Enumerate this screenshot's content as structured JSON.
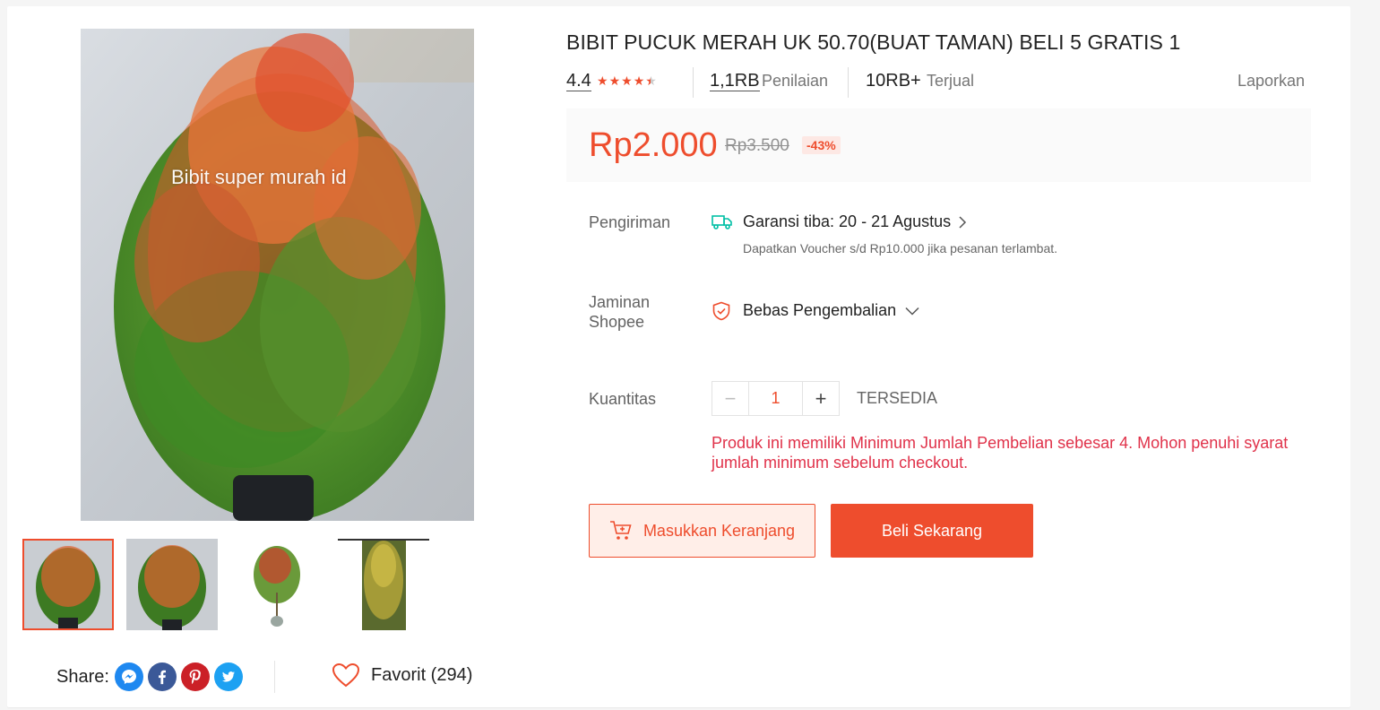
{
  "gallery": {
    "watermark": "Bibit super murah id",
    "thumbnails": [
      "thumb-1",
      "thumb-2",
      "thumb-3",
      "thumb-4"
    ],
    "active_thumbnail": 1
  },
  "share": {
    "label": "Share:",
    "networks": [
      "messenger-icon",
      "facebook-icon",
      "pinterest-icon",
      "twitter-icon"
    ]
  },
  "favorite": {
    "label": "Favorit (294)"
  },
  "product": {
    "title": "BIBIT PUCUK MERAH UK 50.70(BUAT TAMAN) BELI 5 GRATIS 1",
    "rating": "4.4",
    "stars": 4.4,
    "reviews_count": "1,1RB",
    "reviews_label": "Penilaian",
    "sold_count": "10RB+",
    "sold_label": "Terjual",
    "report_label": "Laporkan"
  },
  "price": {
    "current": "Rp2.000",
    "original": "Rp3.500",
    "discount": "-43%"
  },
  "shipping": {
    "label": "Pengiriman",
    "guarantee": "Garansi tiba: 20 - 21 Agustus",
    "voucher_note": "Dapatkan Voucher s/d Rp10.000 jika pesanan terlambat."
  },
  "guarantee": {
    "label_line1": "Jaminan",
    "label_line2": "Shopee",
    "value": "Bebas Pengembalian"
  },
  "quantity": {
    "label": "Kuantitas",
    "value": "1",
    "minus": "−",
    "plus": "+",
    "stock": "TERSEDIA",
    "warning": "Produk ini memiliki Minimum Jumlah Pembelian sebesar 4. Mohon penuhi syarat jumlah minimum sebelum checkout."
  },
  "actions": {
    "add_to_cart": "Masukkan Keranjang",
    "buy_now": "Beli Sekarang"
  },
  "colors": {
    "accent": "#ee4d2d",
    "warning": "#e0324a",
    "shipping_icon": "#00bfa5"
  }
}
